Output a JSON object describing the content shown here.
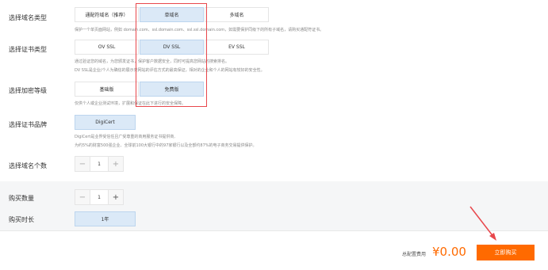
{
  "domain_type": {
    "label": "选择域名类型",
    "options": [
      "通配符域名（推荐）",
      "单域名",
      "多域名"
    ],
    "selected": 1,
    "desc": "保护一个单页面网站，例如 domain.com、ssl.domain.com、ssl.ssl.domain.com，如需要保护同级下的所有子域名，请购买通配符证书。"
  },
  "cert_type": {
    "label": "选择证书类型",
    "options": [
      "OV SSL",
      "DV SSL",
      "EV SSL"
    ],
    "selected": 1,
    "desc_lines": [
      "通过验证您的域名，为您颁发证书，保护客户数据安全，同时可提高您网站的搜索排名。",
      "DV SSL是企业/个人为确信的展示类网站的评估方式的最高保证，相对的企业和个人的网站有较好的安全性。"
    ]
  },
  "encryption": {
    "label": "选择加密等级",
    "options": [
      "基础版",
      "免费版"
    ],
    "selected": 1,
    "desc": "仅供个人或企业测试环境，扩展和保证在此下进行的安全保障。"
  },
  "brand": {
    "label": "选择证书品牌",
    "option": "DigiCert",
    "desc_lines": [
      "DigiCert是业界受信任且广受尊重的商用服务证书提供商,",
      "为约5%的财富500强企业、全球前100大银行中的97家银行以及全部约87%的电子商务交易提供保护。"
    ]
  },
  "domain_count": {
    "label": "选择域名个数",
    "minus": "−",
    "value": "1",
    "plus": "+"
  },
  "purchase_qty": {
    "label": "购买数量",
    "minus": "−",
    "value": "1",
    "plus": "+"
  },
  "duration": {
    "label": "购买时长",
    "option": "1年"
  },
  "footer": {
    "total_label": "总配置费用",
    "price": "¥0.00",
    "buy_label": "立即购买"
  },
  "colors": {
    "accent": "#ff6a00",
    "selected_bg": "#dbe9f7",
    "annotation": "#e8474c"
  }
}
